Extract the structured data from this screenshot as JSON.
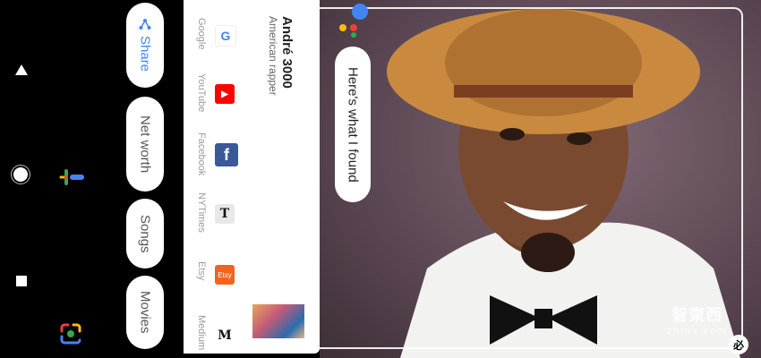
{
  "chips": {
    "share": "Share",
    "net_worth": "Net worth",
    "songs": "Songs",
    "movies": "Movies"
  },
  "card": {
    "title": "André 3000",
    "subtitle": "American rapper",
    "sources": [
      {
        "label": "Google",
        "icon": "google-g-icon",
        "glyph": "G",
        "color": "#ffffff"
      },
      {
        "label": "YouTube",
        "icon": "youtube-icon",
        "glyph": "▶",
        "color": "#ff0000"
      },
      {
        "label": "Facebook",
        "icon": "facebook-icon",
        "glyph": "f",
        "color": "#3b5998"
      },
      {
        "label": "NYTimes",
        "icon": "nytimes-icon",
        "glyph": "𝕿",
        "color": "#e8e8e8"
      },
      {
        "label": "Etsy",
        "icon": "etsy-icon",
        "glyph": "Etsy",
        "color": "#f1641e"
      },
      {
        "label": "Medium",
        "icon": "medium-icon",
        "glyph": "M",
        "color": "#ffffff"
      }
    ]
  },
  "assistant": {
    "response": "Here's what I found"
  },
  "watermark": {
    "logo": "智東西",
    "url": "zhidx.com"
  },
  "corner_button": "必",
  "colors": {
    "google_blue": "#4285F4",
    "google_red": "#EA4335",
    "google_yellow": "#FBBC05",
    "google_green": "#34A853"
  }
}
